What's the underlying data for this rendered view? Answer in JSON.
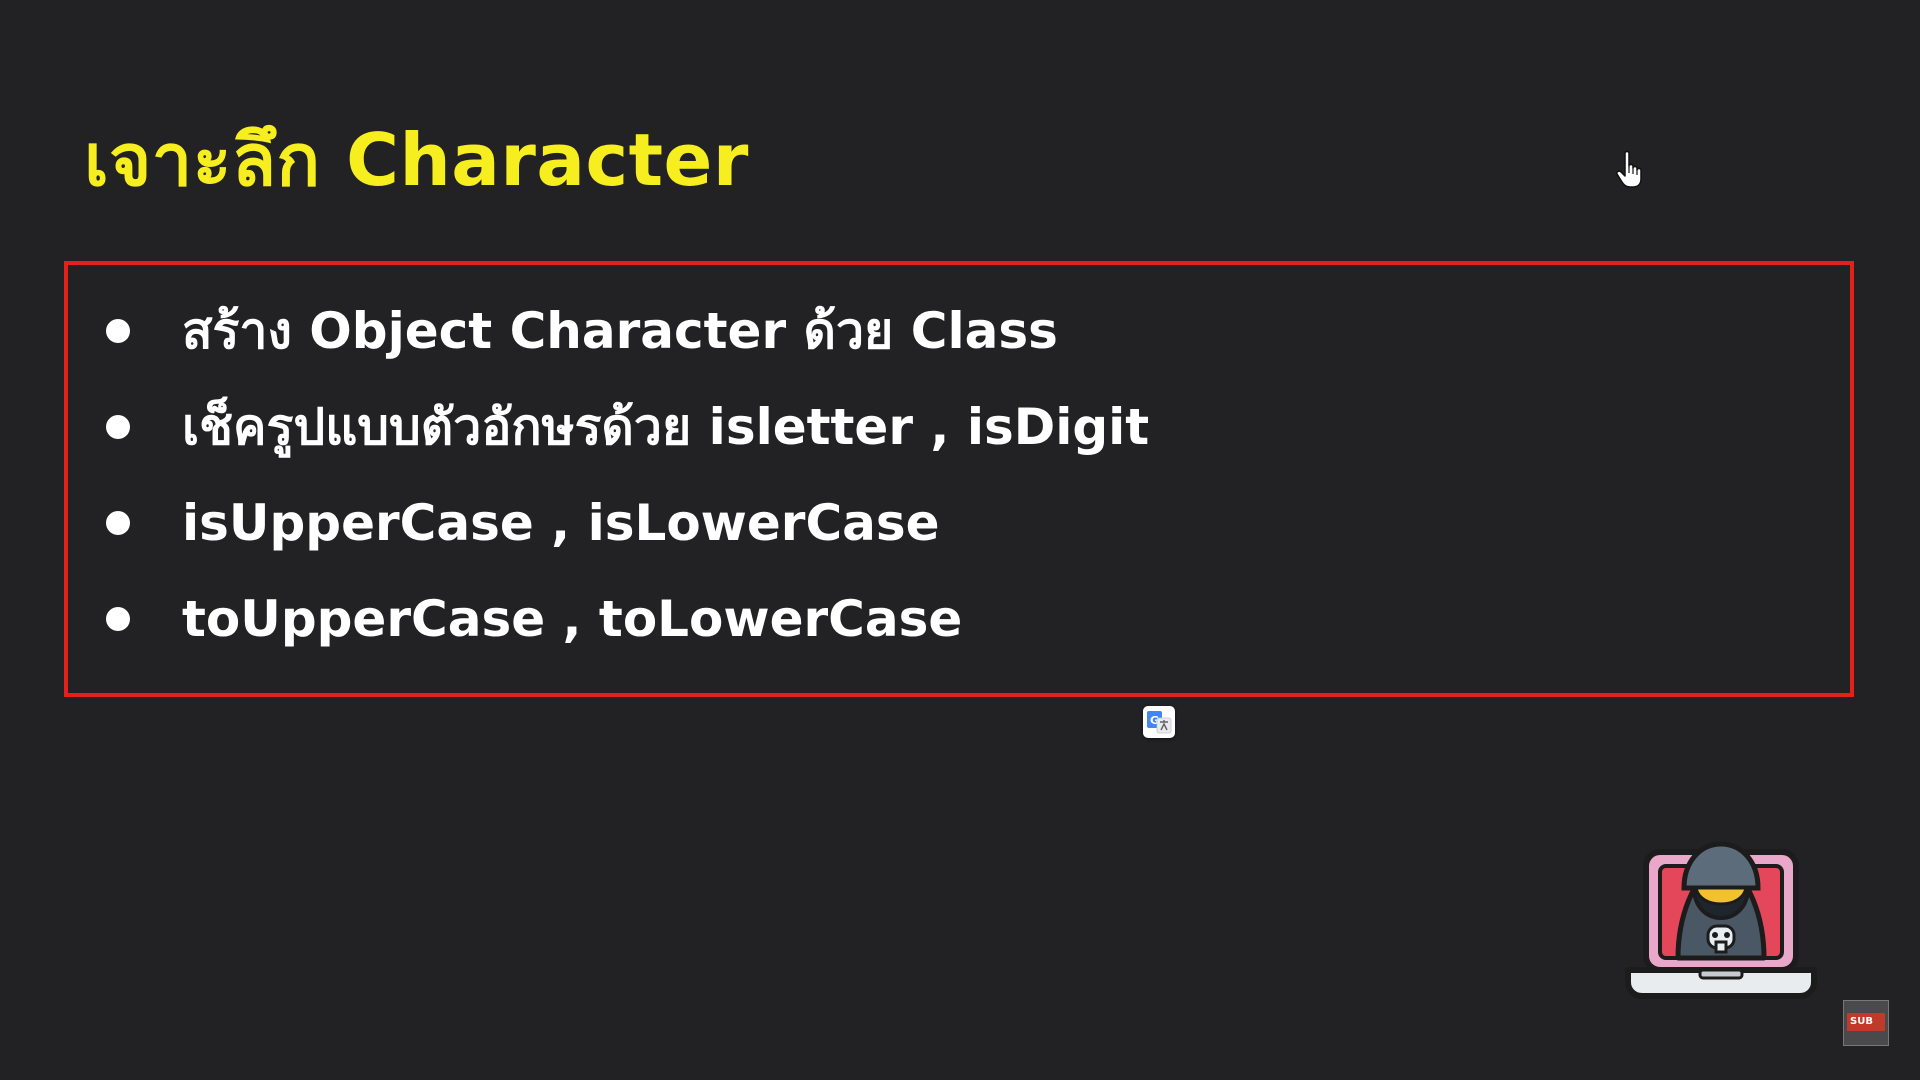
{
  "slide": {
    "title": "เจาะลึก Character",
    "bullets": [
      "สร้าง Object Character ด้วย Class",
      "เช็ครูปแบบตัวอักษรด้วย isletter , isDigit",
      "isUpperCase , isLowerCase",
      "toUpperCase , toLowerCase"
    ]
  },
  "overlay": {
    "sub_badge_label": "SUB",
    "translate_icon_label": "G"
  },
  "colors": {
    "background": "#222224",
    "title": "#f6ee1e",
    "box_border": "#e3211b",
    "text": "#ffffff"
  },
  "icons": {
    "cursor": "hand-pointer-icon",
    "translate": "google-translate-icon",
    "mascot": "hacker-laptop-icon",
    "badge": "subtitle-badge-icon"
  }
}
